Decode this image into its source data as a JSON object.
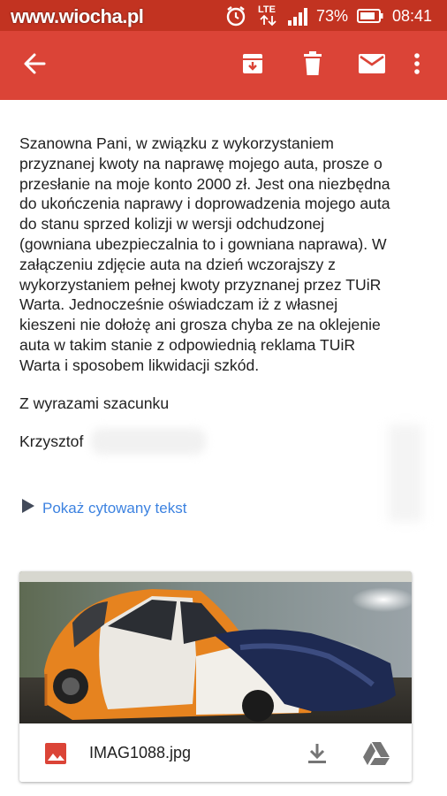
{
  "status_bar": {
    "watermark": "www.wiocha.pl",
    "network": "LTE",
    "battery": "73%",
    "time": "08:41"
  },
  "toolbar": {
    "back": "arrow-back-icon",
    "archive": "archive-icon",
    "delete": "trash-icon",
    "mail": "mail-icon",
    "more": "more-vert-icon",
    "color": "#db4437"
  },
  "message": {
    "lines": [
      "Szanowna Pani, w związku z wykorzystaniem",
      "przyznanej kwoty na naprawę mojego auta, prosze o",
      "przesłanie na moje konto 2000 zł. Jest ona niezbędna",
      "do ukończenia naprawy i doprowadzenia mojego auta",
      "do stanu sprzed kolizji w wersji odchudzonej",
      "(gowniana ubezpieczalnia to i gowniana naprawa). W",
      "załączeniu zdjęcie auta na dzień wczorajszy z",
      "wykorzystaniem pełnej kwoty przyznanej przez TUiR",
      "Warta. Jednocześnie oświadczam iż z własnej",
      "kieszeni nie dołożę ani grosza chyba ze na oklejenie",
      "auta w takim stanie z odpowiednią reklama TUiR",
      "Warta i sposobem likwidacji szkód."
    ],
    "closing": "Z wyrazami szacunku",
    "signature": "Krzysztof"
  },
  "quoted_text_link": "Pokaż cytowany tekst",
  "attachment": {
    "filename": "IMAG1088.jpg",
    "type_icon": "image-icon",
    "download_icon": "download-icon",
    "drive_icon": "drive-icon",
    "accent": "#db4437"
  }
}
